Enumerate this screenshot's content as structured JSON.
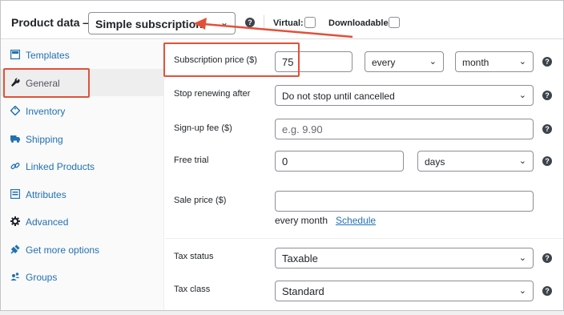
{
  "header": {
    "title": "Product data —",
    "product_type": "Simple subscription",
    "virtual_label": "Virtual:",
    "downloadable_label": "Downloadable:"
  },
  "sidebar": {
    "items": [
      {
        "label": "Templates",
        "icon": "template-icon"
      },
      {
        "label": "General",
        "icon": "wrench-icon",
        "active": true
      },
      {
        "label": "Inventory",
        "icon": "tag-icon"
      },
      {
        "label": "Shipping",
        "icon": "truck-icon"
      },
      {
        "label": "Linked Products",
        "icon": "link-icon"
      },
      {
        "label": "Attributes",
        "icon": "list-icon"
      },
      {
        "label": "Advanced",
        "icon": "gear-icon"
      },
      {
        "label": "Get more options",
        "icon": "plugin-icon"
      },
      {
        "label": "Groups",
        "icon": "groups-icon"
      }
    ]
  },
  "form": {
    "subscription_price": {
      "label": "Subscription price ($)",
      "value": "75",
      "interval": "every",
      "period": "month"
    },
    "stop_renewing": {
      "label": "Stop renewing after",
      "value": "Do not stop until cancelled"
    },
    "signup_fee": {
      "label": "Sign-up fee ($)",
      "placeholder": "e.g. 9.90"
    },
    "free_trial": {
      "label": "Free trial",
      "value": "0",
      "unit": "days"
    },
    "sale_price": {
      "label": "Sale price ($)",
      "value": "",
      "note": "every month",
      "schedule_link": "Schedule"
    },
    "tax_status": {
      "label": "Tax status",
      "value": "Taxable"
    },
    "tax_class": {
      "label": "Tax class",
      "value": "Standard"
    }
  },
  "colors": {
    "accent": "#2271b1",
    "annotation": "#e2503a"
  }
}
